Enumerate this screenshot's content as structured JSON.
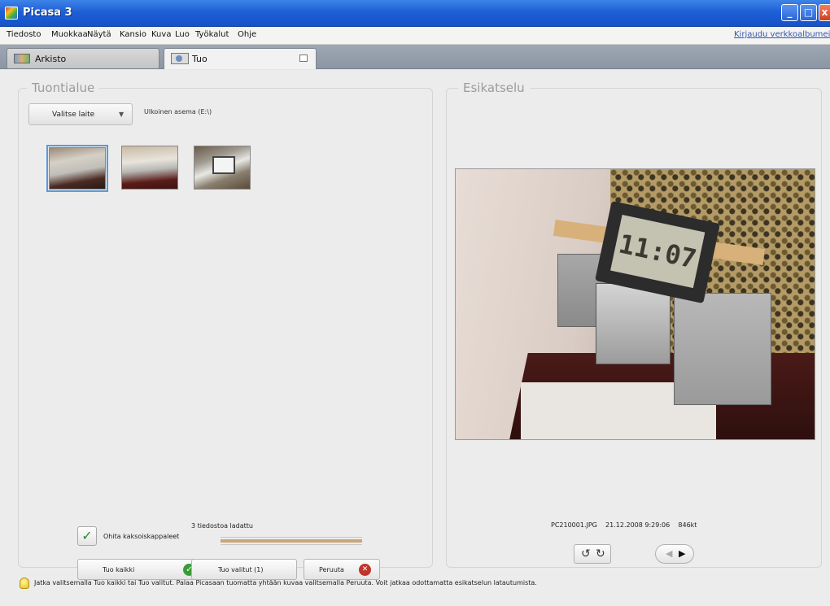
{
  "window": {
    "title": "Picasa 3"
  },
  "menu": {
    "items": [
      "Tiedosto",
      "Muokkaa",
      "Näytä",
      "Kansio",
      "Kuva",
      "Luo",
      "Työkalut",
      "Ohje"
    ],
    "signin_link": "Kirjaudu verkkoalbumeihin"
  },
  "tabs": [
    {
      "label": "Arkisto",
      "icon": "library-icon",
      "active": false
    },
    {
      "label": "Tuo",
      "icon": "import-icon",
      "active": true
    }
  ],
  "import_area": {
    "legend": "Tuontialue",
    "device_button": "Valitse laite",
    "drive_label": "Ulkoinen asema (E:\\)",
    "thumbnails": [
      {
        "name": "thumbnail-1",
        "selected": true
      },
      {
        "name": "thumbnail-2",
        "selected": false
      },
      {
        "name": "thumbnail-3",
        "selected": false
      }
    ],
    "skip_duplicates_label": "Ohita kaksoiskappaleet",
    "skip_duplicates_checked": true,
    "progress_label": "3 tiedostoa ladattu",
    "progress_fraction": 1.0,
    "buttons": {
      "import_all": "Tuo kaikki",
      "import_selected": "Tuo valitut (1)",
      "cancel": "Peruuta"
    }
  },
  "preview": {
    "legend": "Esikatselu",
    "clock_display": "11:07",
    "filename": "PC210001.JPG",
    "datetime": "21.12.2008 9:29:06",
    "filesize": "846kt"
  },
  "hint": "Jatka valitsemalla Tuo kaikki tai Tuo valitut. Palaa Picasaan tuomatta yhtään kuvaa valitsemalla Peruuta. Voit jatkaa odottamatta esikatselun latautumista.",
  "colors": {
    "titlebar": "#1f5fd6",
    "accent_ok": "#3a9a3a",
    "accent_cancel": "#c0352a",
    "progress": "#c9a57a"
  }
}
